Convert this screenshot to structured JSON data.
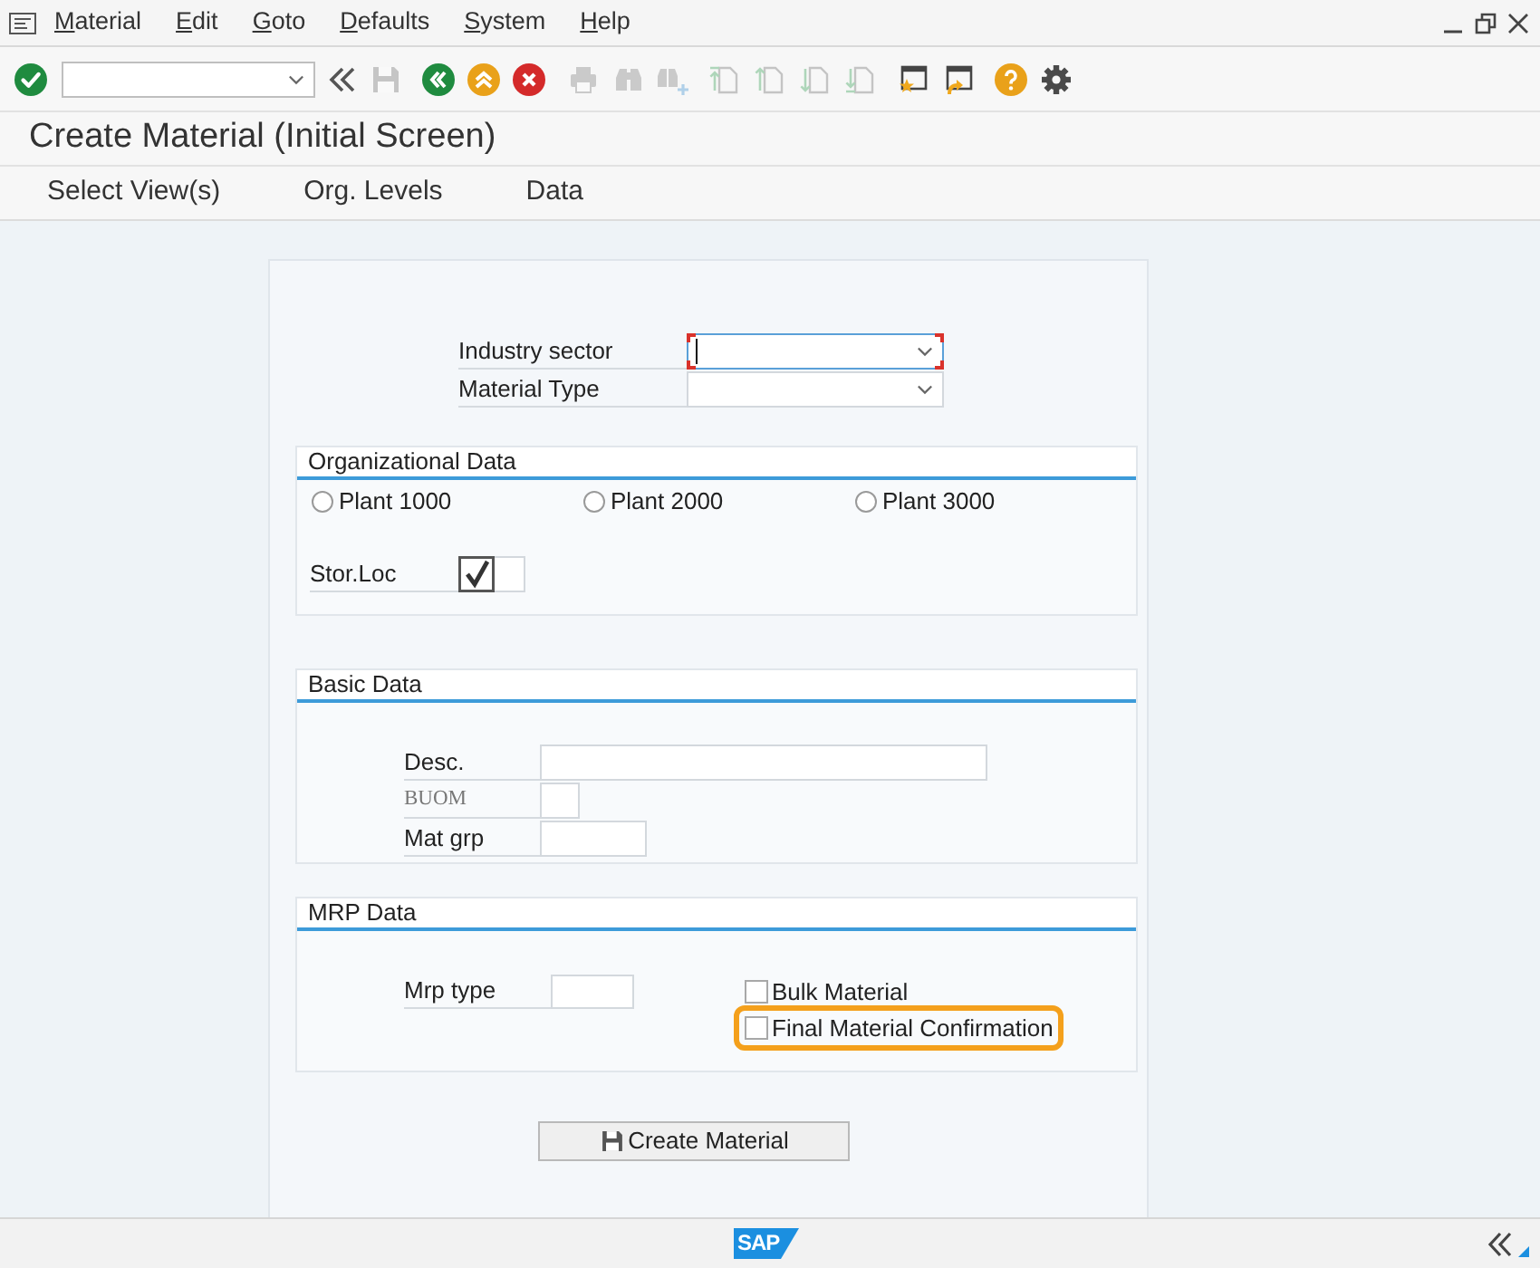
{
  "menu_bar": {
    "items": [
      {
        "label": "Material"
      },
      {
        "label": "Edit"
      },
      {
        "label": "Goto"
      },
      {
        "label": "Defaults"
      },
      {
        "label": "System"
      },
      {
        "label": "Help"
      }
    ]
  },
  "toolbar": {
    "items": [
      {
        "kind": "enter",
        "disabled": false
      },
      {
        "kind": "command_field"
      },
      {
        "kind": "toggle_command",
        "disabled": false
      },
      {
        "kind": "save",
        "disabled": true
      },
      {
        "kind": "back",
        "disabled": false
      },
      {
        "kind": "exit",
        "disabled": false
      },
      {
        "kind": "cancel",
        "disabled": false
      },
      {
        "kind": "print",
        "disabled": true
      },
      {
        "kind": "find",
        "disabled": true
      },
      {
        "kind": "find_next",
        "disabled": true
      },
      {
        "kind": "first_page",
        "disabled": true
      },
      {
        "kind": "previous_page",
        "disabled": true
      },
      {
        "kind": "next_page",
        "disabled": true
      },
      {
        "kind": "last_page",
        "disabled": true
      },
      {
        "kind": "new_session",
        "disabled": false
      },
      {
        "kind": "shortcut",
        "disabled": false
      },
      {
        "kind": "help",
        "disabled": false
      },
      {
        "kind": "customize",
        "disabled": false
      }
    ]
  },
  "title": "Create Material (Initial Screen)",
  "application_toolbar": {
    "buttons": [
      {
        "label": "Select View(s)"
      },
      {
        "label": "Org. Levels"
      },
      {
        "label": "Data"
      }
    ]
  },
  "header_fields": [
    {
      "label": "Industry sector",
      "focused": true
    },
    {
      "label": "Material Type",
      "focused": false
    }
  ],
  "organizational_data": {
    "title": "Organizational Data",
    "plants": [
      {
        "label": "Plant 1000",
        "selected": false
      },
      {
        "label": "Plant 2000",
        "selected": false
      },
      {
        "label": "Plant 3000",
        "selected": false
      }
    ],
    "storage_location": {
      "label": "Stor.Loc",
      "checked": true
    }
  },
  "basic_data": {
    "title": "Basic Data",
    "fields": [
      {
        "label": "Desc.",
        "disabled": false
      },
      {
        "label": "BUOM",
        "disabled": true
      },
      {
        "label": "Mat grp",
        "disabled": false
      }
    ]
  },
  "mrp_data": {
    "title": "MRP Data",
    "fields": [
      {
        "label": "Mrp type"
      }
    ],
    "options": [
      {
        "label": "Bulk Material",
        "checked": false,
        "highlighted": false
      },
      {
        "label": "Final Material Confirmation",
        "checked": false,
        "highlighted": true
      }
    ]
  },
  "create_button": {
    "label": "Create Material"
  },
  "status_bar": {
    "logo": "SAP"
  }
}
